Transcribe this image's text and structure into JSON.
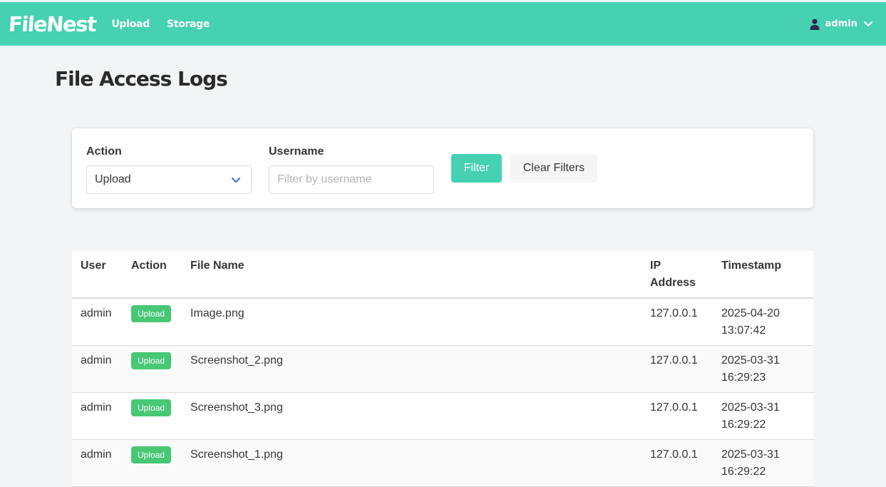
{
  "navbar": {
    "brand": "FileNest",
    "links": [
      "Upload",
      "Storage"
    ],
    "user": "admin",
    "user_icon": "user-icon",
    "menu_icon": "chevron-down-icon",
    "bg_color": "#45d1b2"
  },
  "page": {
    "title": "File Access Logs"
  },
  "filters": {
    "action_label": "Action",
    "action_value": "Upload",
    "username_label": "Username",
    "username_placeholder": "Filter by username",
    "username_value": "",
    "filter_button": "Filter",
    "clear_button": "Clear Filters"
  },
  "table": {
    "headers": [
      "User",
      "Action",
      "File Name",
      "IP Address",
      "Timestamp"
    ],
    "rows": [
      {
        "user": "admin",
        "action": "Upload",
        "file": "Image.png",
        "ip": "127.0.0.1",
        "date": "2025-04-20",
        "time": "13:07:42"
      },
      {
        "user": "admin",
        "action": "Upload",
        "file": "Screenshot_2.png",
        "ip": "127.0.0.1",
        "date": "2025-03-31",
        "time": "16:29:23"
      },
      {
        "user": "admin",
        "action": "Upload",
        "file": "Screenshot_3.png",
        "ip": "127.0.0.1",
        "date": "2025-03-31",
        "time": "16:29:22"
      },
      {
        "user": "admin",
        "action": "Upload",
        "file": "Screenshot_1.png",
        "ip": "127.0.0.1",
        "date": "2025-03-31",
        "time": "16:29:22"
      }
    ],
    "tag_color": "#48c774"
  }
}
